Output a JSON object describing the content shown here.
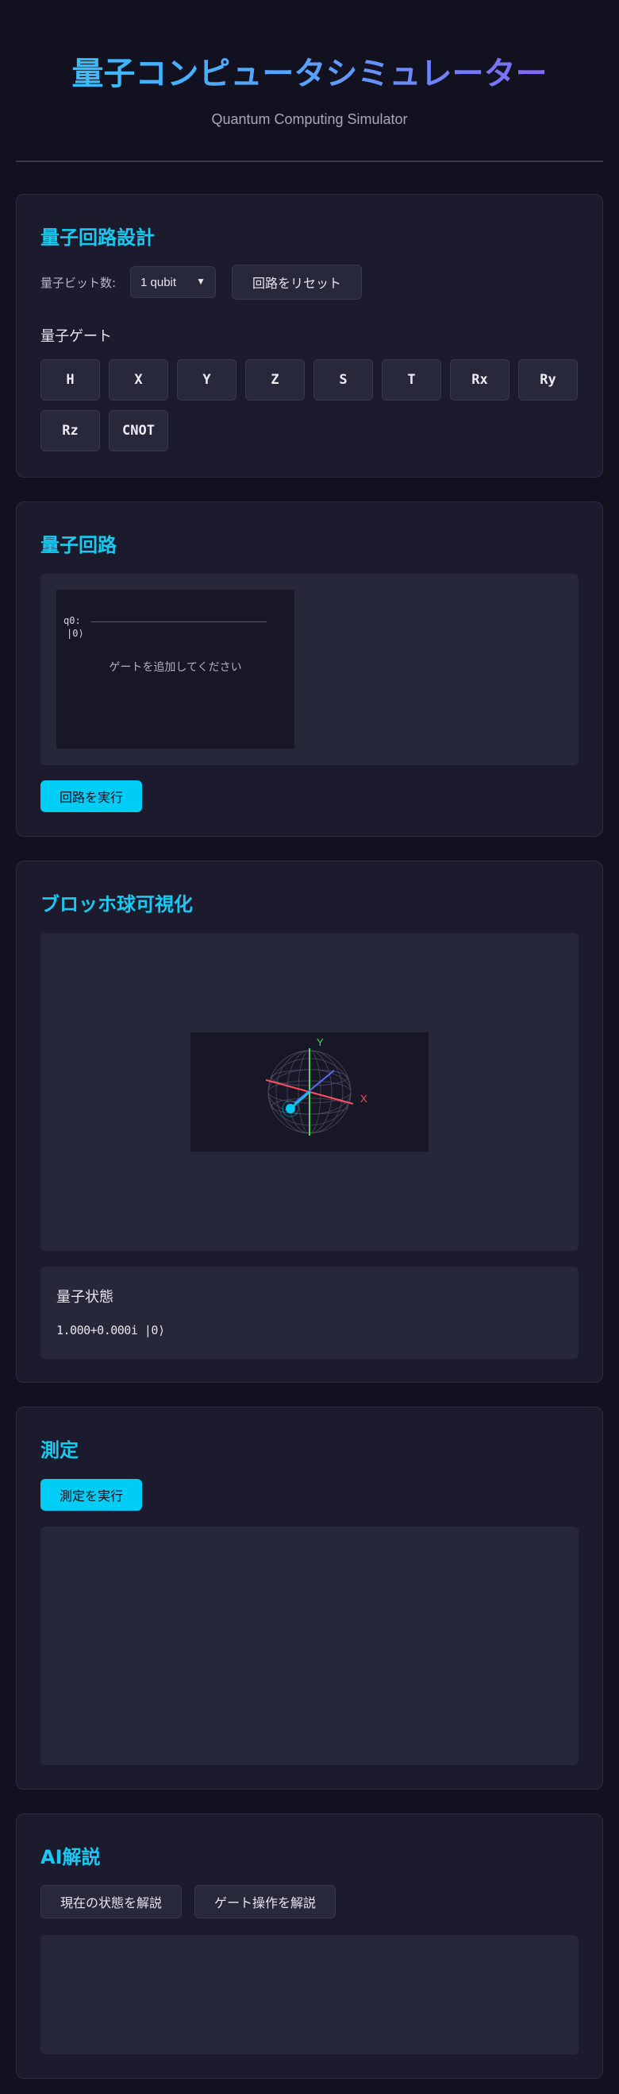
{
  "header": {
    "title": "量子コンピュータシミュレーター",
    "subtitle": "Quantum Computing Simulator"
  },
  "design": {
    "title": "量子回路設計",
    "qubit_label": "量子ビット数:",
    "qubit_value": "1 qubit",
    "reset_label": "回路をリセット",
    "gates_title": "量子ゲート",
    "gates": [
      "H",
      "X",
      "Y",
      "Z",
      "S",
      "T",
      "Rx",
      "Ry",
      "Rz",
      "CNOT"
    ]
  },
  "circuit": {
    "title": "量子回路",
    "wire_label": "q0:",
    "wire_state": "|0⟩",
    "placeholder": "ゲートを追加してください",
    "run_label": "回路を実行"
  },
  "bloch": {
    "title": "ブロッホ球可視化",
    "axis_x": "X",
    "axis_y": "Y",
    "state_title": "量子状態",
    "state_value": "1.000+0.000i |0⟩"
  },
  "measure": {
    "title": "測定",
    "run_label": "測定を実行"
  },
  "ai": {
    "title": "AI解説",
    "explain_state_label": "現在の状態を解説",
    "explain_gate_label": "ゲート操作を解説"
  },
  "colors": {
    "accent": "#00cdf5",
    "title_gradient_start": "#2fc3ff",
    "title_gradient_end": "#8a5cf0",
    "x_axis": "#ff4d5e",
    "y_axis": "#4ddf5a",
    "z_axis": "#5a6bff"
  }
}
